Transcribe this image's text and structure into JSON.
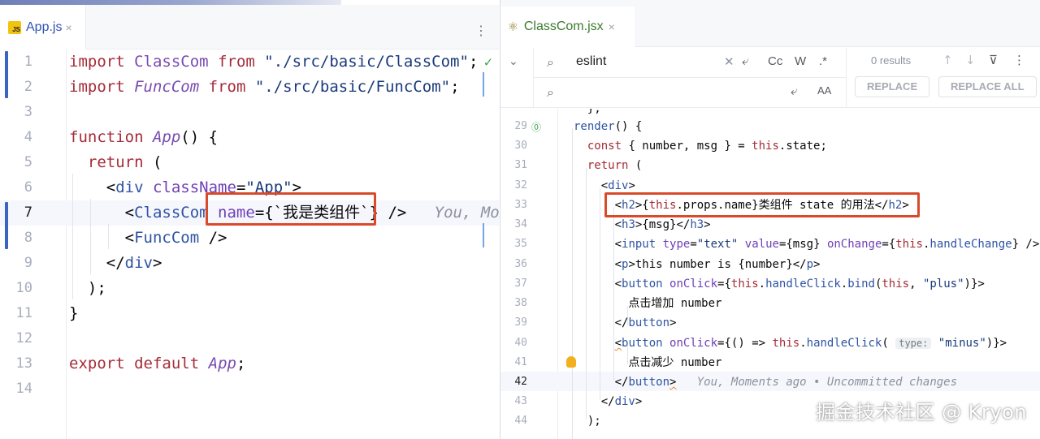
{
  "left_tab": {
    "label": "App.js",
    "icon": "js-file-icon",
    "badge": "JS",
    "close": "×",
    "more": "⋮"
  },
  "right_tab": {
    "label": "ClassCom.jsx",
    "icon": "react-file-icon",
    "close": "×"
  },
  "left_editor": {
    "line_numbers": [
      "1",
      "2",
      "3",
      "4",
      "5",
      "6",
      "7",
      "8",
      "9",
      "10",
      "11",
      "12",
      "13",
      "14"
    ],
    "current_line": 7,
    "inlay_hint": "You, Mome"
  },
  "find_bar": {
    "query": "eslint",
    "results": "0 results",
    "replace_label": "REPLACE",
    "replace_all_label": "REPLACE ALL",
    "opt_case": "Cc",
    "opt_words": "W",
    "opt_regex": ".*",
    "opt_preserve_case": "AA"
  },
  "right_editor": {
    "line_numbers": [
      "29",
      "30",
      "31",
      "32",
      "33",
      "34",
      "35",
      "36",
      "37",
      "38",
      "39",
      "40",
      "41",
      "42",
      "43",
      "44"
    ],
    "current_line": 42,
    "blame_hint": "You, Moments ago • Uncommitted changes",
    "param_hint": "type:"
  },
  "watermark": "掘金技术社区 @ Kryon",
  "colors": {
    "highlight_box": "#d94a2b",
    "vcs_bar": "#3b63c4",
    "keyword": "#a52c39"
  }
}
